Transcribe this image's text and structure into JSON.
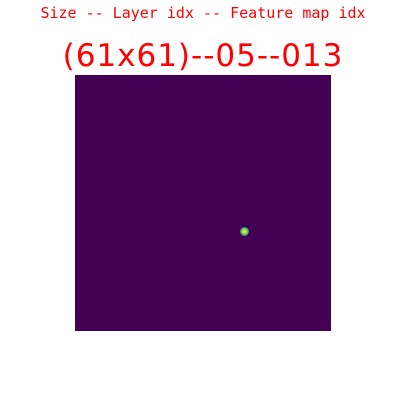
{
  "header": {
    "caption": "Size -- Layer idx -- Feature map idx",
    "title": "(61x61)--05--013"
  },
  "feature_map": {
    "colormap": "viridis",
    "background_color": "#440154",
    "hotspot_color": "#fde725"
  }
}
